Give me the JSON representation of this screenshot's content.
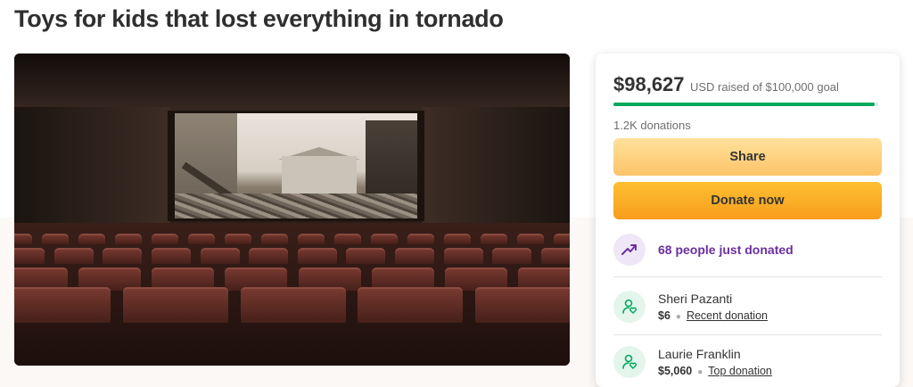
{
  "page": {
    "title": "Toys for kids that lost everything in tornado"
  },
  "hero_image": {
    "icon": "campaign-photo-theater-tornado-damage"
  },
  "fundraiser": {
    "raised": "$98,627",
    "goal_text": "USD raised of $100,000 goal",
    "progress_percent": 98.6,
    "donation_count": "1.2K donations",
    "share_label": "Share",
    "donate_label": "Donate now",
    "momentum_text": "68 people just donated",
    "momentum_icon": "trending-up-icon",
    "accent_green": "#02a95c",
    "accent_purple": "#6b2fa0"
  },
  "donors": [
    {
      "name": "Sheri Pazanti",
      "amount": "$6",
      "tag": "Recent donation",
      "icon": "donor-heart-icon"
    },
    {
      "name": "Laurie Franklin",
      "amount": "$5,060",
      "tag": "Top donation",
      "icon": "donor-heart-icon"
    }
  ]
}
